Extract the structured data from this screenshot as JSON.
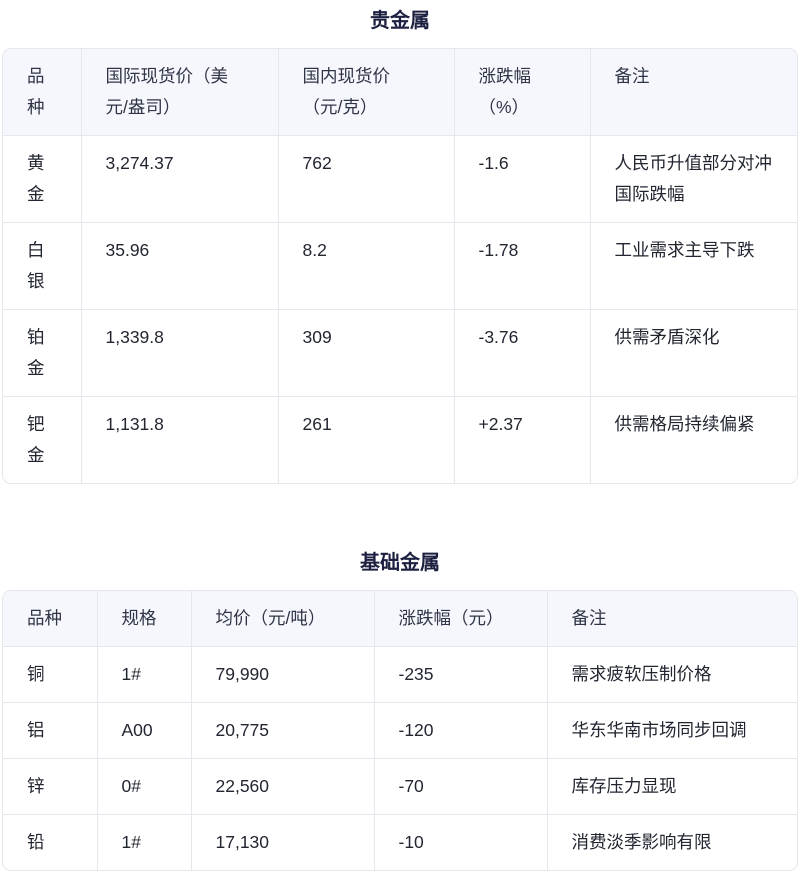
{
  "precious": {
    "title": "贵金属",
    "headers": [
      "品种",
      "国际现货价（美元/盎司）",
      "国内现货价（元/克）",
      "涨跌幅（%）",
      "备注"
    ],
    "rows": [
      [
        "黄金",
        "3,274.37",
        "762",
        "-1.6",
        "人民币升值部分对冲国际跌幅"
      ],
      [
        "白银",
        "35.96",
        "8.2",
        "-1.78",
        "工业需求主导下跌"
      ],
      [
        "铂金",
        "1,339.8",
        "309",
        "-3.76",
        "供需矛盾深化"
      ],
      [
        "钯金",
        "1,131.8",
        "261",
        "+2.37",
        "供需格局持续偏紧"
      ]
    ]
  },
  "base": {
    "title": "基础金属",
    "headers": [
      "品种",
      "规格",
      "均价（元/吨）",
      "涨跌幅（元）",
      "备注"
    ],
    "rows": [
      [
        "铜",
        "1#",
        "79,990",
        "-235",
        "需求疲软压制价格"
      ],
      [
        "铝",
        "A00",
        "20,775",
        "-120",
        "华东华南市场同步回调"
      ],
      [
        "锌",
        "0#",
        "22,560",
        "-70",
        "库存压力显现"
      ],
      [
        "铅",
        "1#",
        "17,130",
        "-10",
        "消费淡季影响有限"
      ]
    ]
  }
}
